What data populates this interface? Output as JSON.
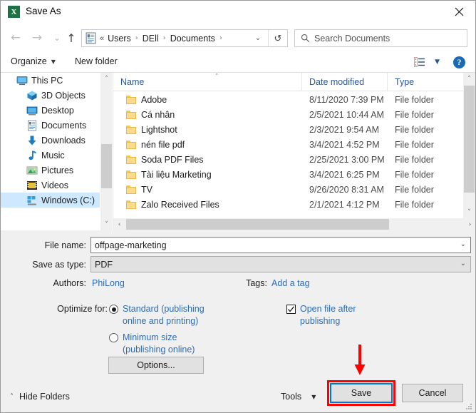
{
  "window": {
    "title": "Save As",
    "app_icon": "excel-icon",
    "close_label": "✕"
  },
  "nav": {
    "back_icon": "←",
    "forward_icon": "→",
    "recent_icon": "⌄",
    "up_icon": "↑",
    "address_icon": "documents-folder-icon",
    "breadcrumb_prefix": "«",
    "breadcrumbs": [
      "Users",
      "DEll",
      "Documents"
    ],
    "separator": "›",
    "dropdown_caret": "⌄",
    "refresh_icon": "↺"
  },
  "search": {
    "placeholder": "Search Documents",
    "icon": "search-icon"
  },
  "toolbar": {
    "organize_label": "Organize",
    "organize_caret": "▼",
    "new_folder_label": "New folder",
    "view_icon": "view-layout-icon",
    "view_caret": "▼",
    "help_label": "?"
  },
  "sidebar": {
    "scroll_up": "˄",
    "scroll_down": "˅",
    "items": [
      {
        "label": "This PC",
        "icon": "monitor-icon",
        "level": "root",
        "selected": false
      },
      {
        "label": "3D Objects",
        "icon": "cube-icon",
        "level": "child",
        "selected": false
      },
      {
        "label": "Desktop",
        "icon": "desktop-icon",
        "level": "child",
        "selected": false
      },
      {
        "label": "Documents",
        "icon": "documents-icon",
        "level": "child",
        "selected": false
      },
      {
        "label": "Downloads",
        "icon": "download-icon",
        "level": "child",
        "selected": false
      },
      {
        "label": "Music",
        "icon": "music-note-icon",
        "level": "child",
        "selected": false
      },
      {
        "label": "Pictures",
        "icon": "picture-icon",
        "level": "child",
        "selected": false
      },
      {
        "label": "Videos",
        "icon": "video-icon",
        "level": "child",
        "selected": false
      },
      {
        "label": "Windows (C:)",
        "icon": "hard-drive-icon",
        "level": "child",
        "selected": true
      }
    ]
  },
  "filelist": {
    "columns": [
      "Name",
      "Date modified",
      "Type"
    ],
    "sort_caret": "˄",
    "scroll_up": "˄",
    "scroll_down": "˅",
    "scroll_left": "‹",
    "scroll_right": "›",
    "rows": [
      {
        "name": "Adobe",
        "date": "8/11/2020 7:39 PM",
        "type": "File folder"
      },
      {
        "name": "Cá nhân",
        "date": "2/5/2021 10:44 AM",
        "type": "File folder"
      },
      {
        "name": "Lightshot",
        "date": "2/3/2021 9:54 AM",
        "type": "File folder"
      },
      {
        "name": "nén file pdf",
        "date": "3/4/2021 4:52 PM",
        "type": "File folder"
      },
      {
        "name": "Soda PDF Files",
        "date": "2/25/2021 3:00 PM",
        "type": "File folder"
      },
      {
        "name": "Tài liệu Marketing",
        "date": "3/4/2021 6:25 PM",
        "type": "File folder"
      },
      {
        "name": "TV",
        "date": "9/26/2020 8:31 AM",
        "type": "File folder"
      },
      {
        "name": "Zalo Received Files",
        "date": "2/1/2021 4:12 PM",
        "type": "File folder"
      }
    ]
  },
  "form": {
    "filename_label": "File name:",
    "filename_value": "offpage-marketing",
    "filename_caret": "⌄",
    "savetype_label": "Save as type:",
    "savetype_value": "PDF",
    "savetype_caret": "⌄",
    "authors_label": "Authors:",
    "authors_value": "PhiLong",
    "tags_label": "Tags:",
    "tags_value": "Add a tag",
    "optimize_label": "Optimize for:",
    "radio_standard": "Standard (publishing online and printing)",
    "radio_minimum": "Minimum size (publishing online)",
    "radio_selected": "standard",
    "checkbox_open_label": "Open file after publishing",
    "checkbox_open_checked": true,
    "checkbox_glyph": "✓",
    "options_label": "Options..."
  },
  "footer": {
    "hide_folders_label": "Hide Folders",
    "hide_folders_caret": "˄",
    "tools_label": "Tools",
    "tools_caret": "▼",
    "save_label": "Save",
    "cancel_label": "Cancel"
  },
  "annotation": {
    "arrow_color": "#ff0000",
    "highlight_color": "#ff0000",
    "target": "save-button"
  }
}
